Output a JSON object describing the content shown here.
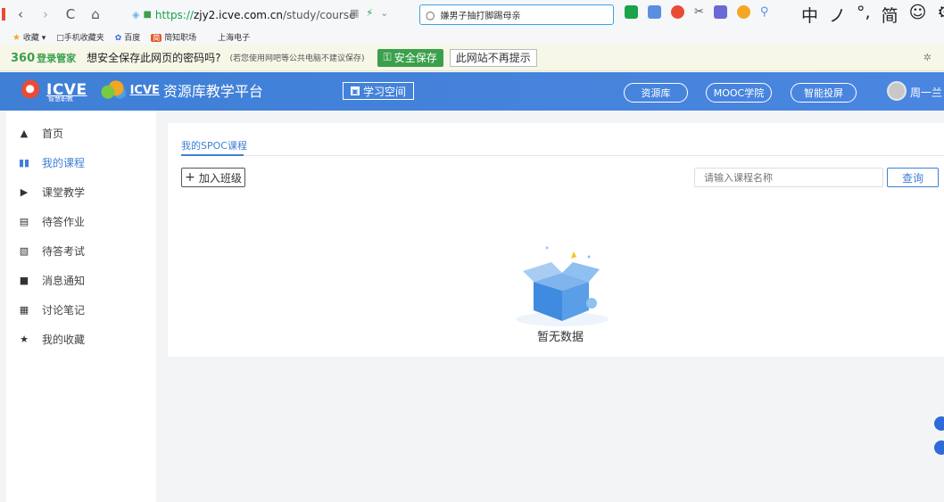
{
  "browser": {
    "back": "‹",
    "forward": "›",
    "reload": "C",
    "home": "⌂",
    "url_scheme": "https://",
    "url_host": "zjy2.icve.com.cn",
    "url_path": "/study/course",
    "search_query": "嫌男子抽打脚踢母亲",
    "ime_text": [
      "中",
      "ノ",
      "°,",
      "简",
      "☺",
      "⚙"
    ]
  },
  "bookmarks": {
    "items": [
      "收藏",
      "手机收藏夹",
      "百度",
      "简知职场",
      "上海电子"
    ]
  },
  "password_bar": {
    "brand": "360",
    "brand_sub": "登录管家",
    "question": "想安全保存此网页的密码吗?",
    "note": "(若您使用网吧等公共电脑不建议保存)",
    "save_label": "安全保存",
    "never_label": "此网站不再提示"
  },
  "header": {
    "logo_text": "icve",
    "logo_sub": "智慧职教",
    "logo2_text": "icve",
    "platform": "资源库教学平台",
    "learn_space": "学习空间",
    "nav": [
      "资源库",
      "MOOC学院",
      "智能投屏"
    ],
    "username": "周一兰"
  },
  "sidebar": {
    "items": [
      {
        "label": "首页",
        "icon": "home-icon"
      },
      {
        "label": "我的课程",
        "icon": "book-icon"
      },
      {
        "label": "课堂教学",
        "icon": "classroom-icon"
      },
      {
        "label": "待答作业",
        "icon": "homework-icon"
      },
      {
        "label": "待答考试",
        "icon": "exam-icon"
      },
      {
        "label": "消息通知",
        "icon": "message-icon"
      },
      {
        "label": "讨论笔记",
        "icon": "notes-icon"
      },
      {
        "label": "我的收藏",
        "icon": "favorite-icon"
      }
    ],
    "active_index": 1
  },
  "main": {
    "tab_label": "我的SPOC课程",
    "join_label": "加入班级",
    "search_placeholder": "请输入课程名称",
    "query_label": "查询",
    "empty_text": "暂无数据"
  },
  "colors": {
    "accent": "#3f7fd6",
    "password_green": "#3aa04c"
  }
}
